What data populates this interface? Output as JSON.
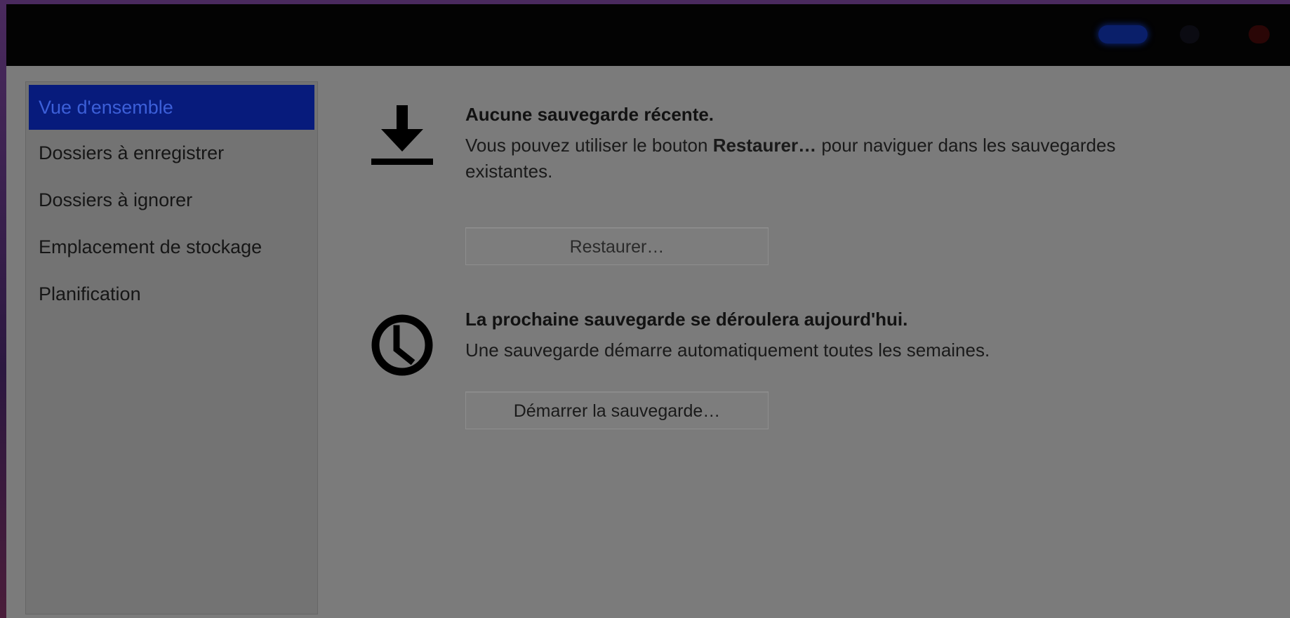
{
  "sidebar": {
    "items": [
      {
        "label": "Vue d'ensemble",
        "selected": true
      },
      {
        "label": "Dossiers à enregistrer",
        "selected": false
      },
      {
        "label": "Dossiers à ignorer",
        "selected": false
      },
      {
        "label": "Emplacement de stockage",
        "selected": false
      },
      {
        "label": "Planification",
        "selected": false
      }
    ]
  },
  "backup_status": {
    "heading": "Aucune sauvegarde récente.",
    "description_prefix": "Vous pouvez utiliser le bouton ",
    "description_bold": "Restaurer…",
    "description_suffix": " pour naviguer dans les sauvegardes existantes.",
    "button_label": "Restaurer…",
    "icon": "download-icon"
  },
  "next_backup": {
    "heading": "La prochaine sauvegarde se déroulera aujourd'hui.",
    "description": "Une sauvegarde démarre automatiquement toutes les semaines.",
    "button_label": "Démarrer la sauvegarde…",
    "icon": "clock-icon"
  },
  "colors": {
    "selection": "#071b7c",
    "titlebar": "#030303",
    "window_bg": "#7b7b7b"
  }
}
